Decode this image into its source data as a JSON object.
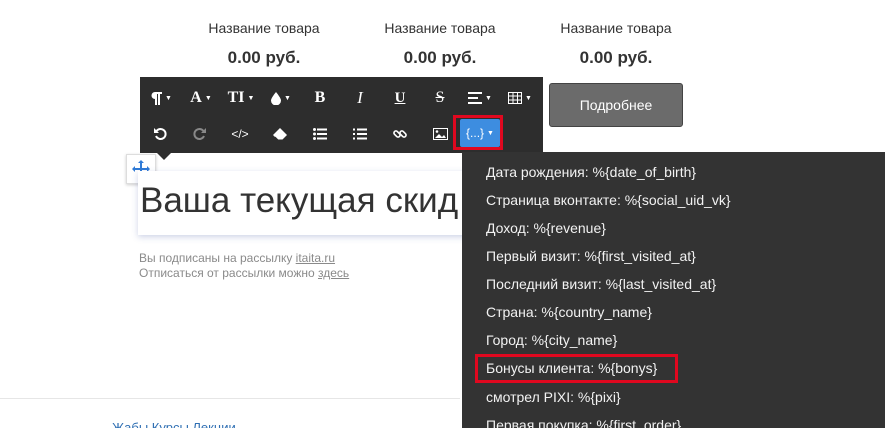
{
  "products": [
    {
      "name": "Название товара",
      "price": "0.00 руб."
    },
    {
      "name": "Название товара",
      "price": "0.00 руб."
    },
    {
      "name": "Название товара",
      "price": "0.00 руб."
    }
  ],
  "more_button": "Подробнее",
  "toolbar": {
    "row1": [
      "paragraph-icon",
      "font-color-icon",
      "font-size-icon",
      "color-drop-icon",
      "bold-icon",
      "italic-icon",
      "underline-icon",
      "strikethrough-icon",
      "align-icon",
      "table-icon"
    ],
    "row2": [
      "undo-icon",
      "redo-icon",
      "code-icon",
      "eraser-icon",
      "bullet-list-icon",
      "numbered-list-icon",
      "link-icon",
      "image-icon"
    ],
    "variables_button": "{...}"
  },
  "heading": "Ваша текущая скид",
  "footer": {
    "subscribed_prefix": "Вы подписаны на рассылку",
    "site_link": "itaita.ru",
    "unsubscribe_prefix": "Отписаться от рассылки можно",
    "unsubscribe_link": "здесь"
  },
  "bottom_nav_partial": "Жабы   Курсы   Лекции",
  "dropdown": {
    "items": [
      "Дата рождения: %{date_of_birth}",
      "Страница вконтакте: %{social_uid_vk}",
      "Доход: %{revenue}",
      "Первый визит: %{first_visited_at}",
      "Последний визит: %{last_visited_at}",
      "Страна: %{country_name}",
      "Город: %{city_name}",
      "Бонусы клиента: %{bonys}",
      "смотрел PIXI: %{pixi}",
      "Первая покупка: %{first_order}"
    ],
    "highlighted_index": 7
  },
  "colors": {
    "toolbar_bg": "#2d2d2d",
    "dropdown_bg": "#333333",
    "accent": "#3d8de0",
    "highlight": "#e0081f"
  }
}
